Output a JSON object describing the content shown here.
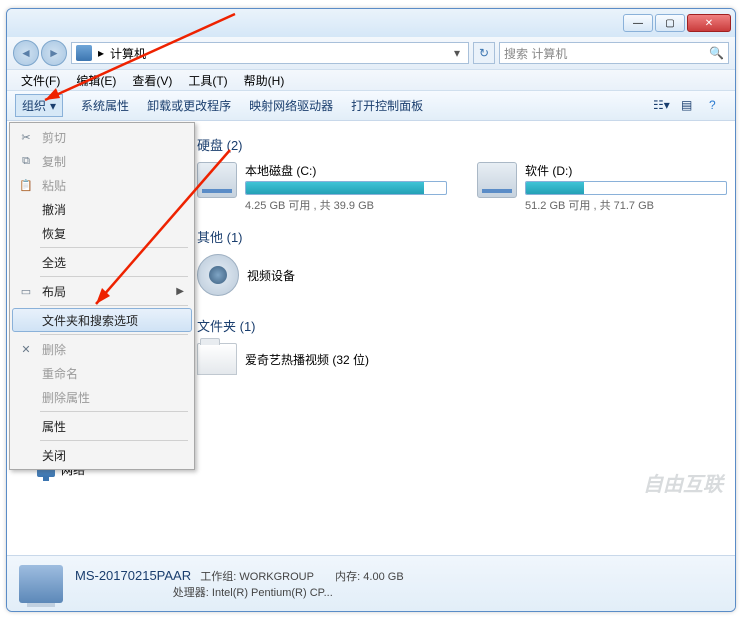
{
  "titlebar": {
    "min": "—",
    "max": "▢",
    "close": "✕"
  },
  "address": {
    "location": "计算机",
    "arrow": "▸",
    "drop": "▾",
    "refresh": "↻"
  },
  "search": {
    "placeholder": "搜索 计算机",
    "icon": "🔍"
  },
  "menubar": [
    "文件(F)",
    "编辑(E)",
    "查看(V)",
    "工具(T)",
    "帮助(H)"
  ],
  "toolbar": {
    "organize": "组织",
    "items": [
      "系统属性",
      "卸载或更改程序",
      "映射网络驱动器",
      "打开控制面板"
    ]
  },
  "dropdown": [
    {
      "label": "剪切",
      "icon": "✂",
      "disabled": true
    },
    {
      "label": "复制",
      "icon": "⧉",
      "disabled": true
    },
    {
      "label": "粘贴",
      "icon": "📋",
      "disabled": true
    },
    {
      "label": "撤消"
    },
    {
      "label": "恢复"
    },
    {
      "sep": true
    },
    {
      "label": "全选"
    },
    {
      "sep": true
    },
    {
      "label": "布局",
      "icon": "▭",
      "submenu": true
    },
    {
      "sep": true
    },
    {
      "label": "文件夹和搜索选项",
      "hover": true
    },
    {
      "sep": true
    },
    {
      "label": "删除",
      "icon": "✕",
      "disabled": true
    },
    {
      "label": "重命名",
      "disabled": true
    },
    {
      "label": "删除属性",
      "disabled": true
    },
    {
      "sep": true
    },
    {
      "label": "属性"
    },
    {
      "sep": true
    },
    {
      "label": "关闭"
    }
  ],
  "sections": {
    "hdd": {
      "title": "硬盘 (2)"
    },
    "other": {
      "title": "其他 (1)",
      "device": "视频设备"
    },
    "folders": {
      "title": "文件夹 (1)",
      "item": "爱奇艺热播视频 (32 位)"
    }
  },
  "drives": [
    {
      "name": "本地磁盘 (C:)",
      "free_text": "4.25 GB 可用 , 共 39.9 GB",
      "fill_pct": 89
    },
    {
      "name": "软件 (D:)",
      "free_text": "51.2 GB 可用 , 共 71.7 GB",
      "fill_pct": 29
    }
  ],
  "tree": {
    "network": "网络"
  },
  "details": {
    "name": "MS-20170215PAAR",
    "workgroup_label": "工作组:",
    "workgroup": "WORKGROUP",
    "mem_label": "内存:",
    "mem": "4.00 GB",
    "cpu_label": "处理器:",
    "cpu": "Intel(R) Pentium(R) CP..."
  },
  "watermark": "自由互联"
}
